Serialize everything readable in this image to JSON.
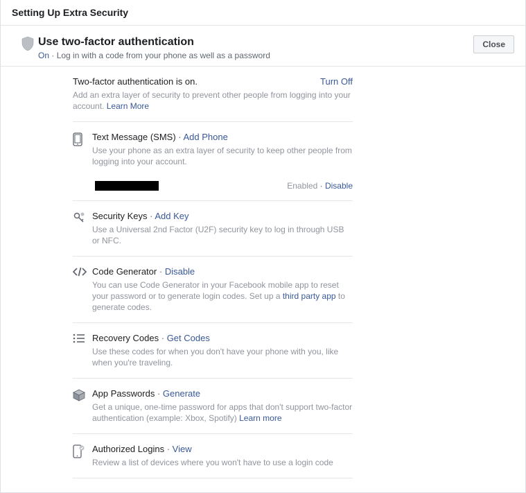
{
  "page_title": "Setting Up Extra Security",
  "header": {
    "title": "Use two-factor authentication",
    "status": "On",
    "status_desc": "Log in with a code from your phone as well as a password",
    "close_label": "Close"
  },
  "intro": {
    "heading": "Two-factor authentication is on.",
    "turn_off": "Turn Off",
    "desc": "Add an extra layer of security to prevent other people from logging into your account.",
    "learn_more": "Learn More"
  },
  "sms": {
    "title": "Text Message (SMS)",
    "action": "Add Phone",
    "desc": "Use your phone as an extra layer of security to keep other people from logging into your account.",
    "enabled": "Enabled",
    "disable": "Disable"
  },
  "keys": {
    "title": "Security Keys",
    "action": "Add Key",
    "desc": "Use a Universal 2nd Factor (U2F) security key to log in through USB or NFC."
  },
  "codegen": {
    "title": "Code Generator",
    "action": "Disable",
    "desc1": "You can use Code Generator in your Facebook mobile app to reset your password or to generate login codes. Set up a ",
    "third_party": "third party app",
    "desc2": " to generate codes."
  },
  "recovery": {
    "title": "Recovery Codes",
    "action": "Get Codes",
    "desc": "Use these codes for when you don't have your phone with you, like when you're traveling."
  },
  "apppw": {
    "title": "App Passwords",
    "action": "Generate",
    "desc": "Get a unique, one-time password for apps that don't support two-factor authentication (example: Xbox, Spotify) ",
    "learn_more": "Learn more"
  },
  "authlogins": {
    "title": "Authorized Logins",
    "action": "View",
    "desc": "Review a list of devices where you won't have to use a login code"
  }
}
